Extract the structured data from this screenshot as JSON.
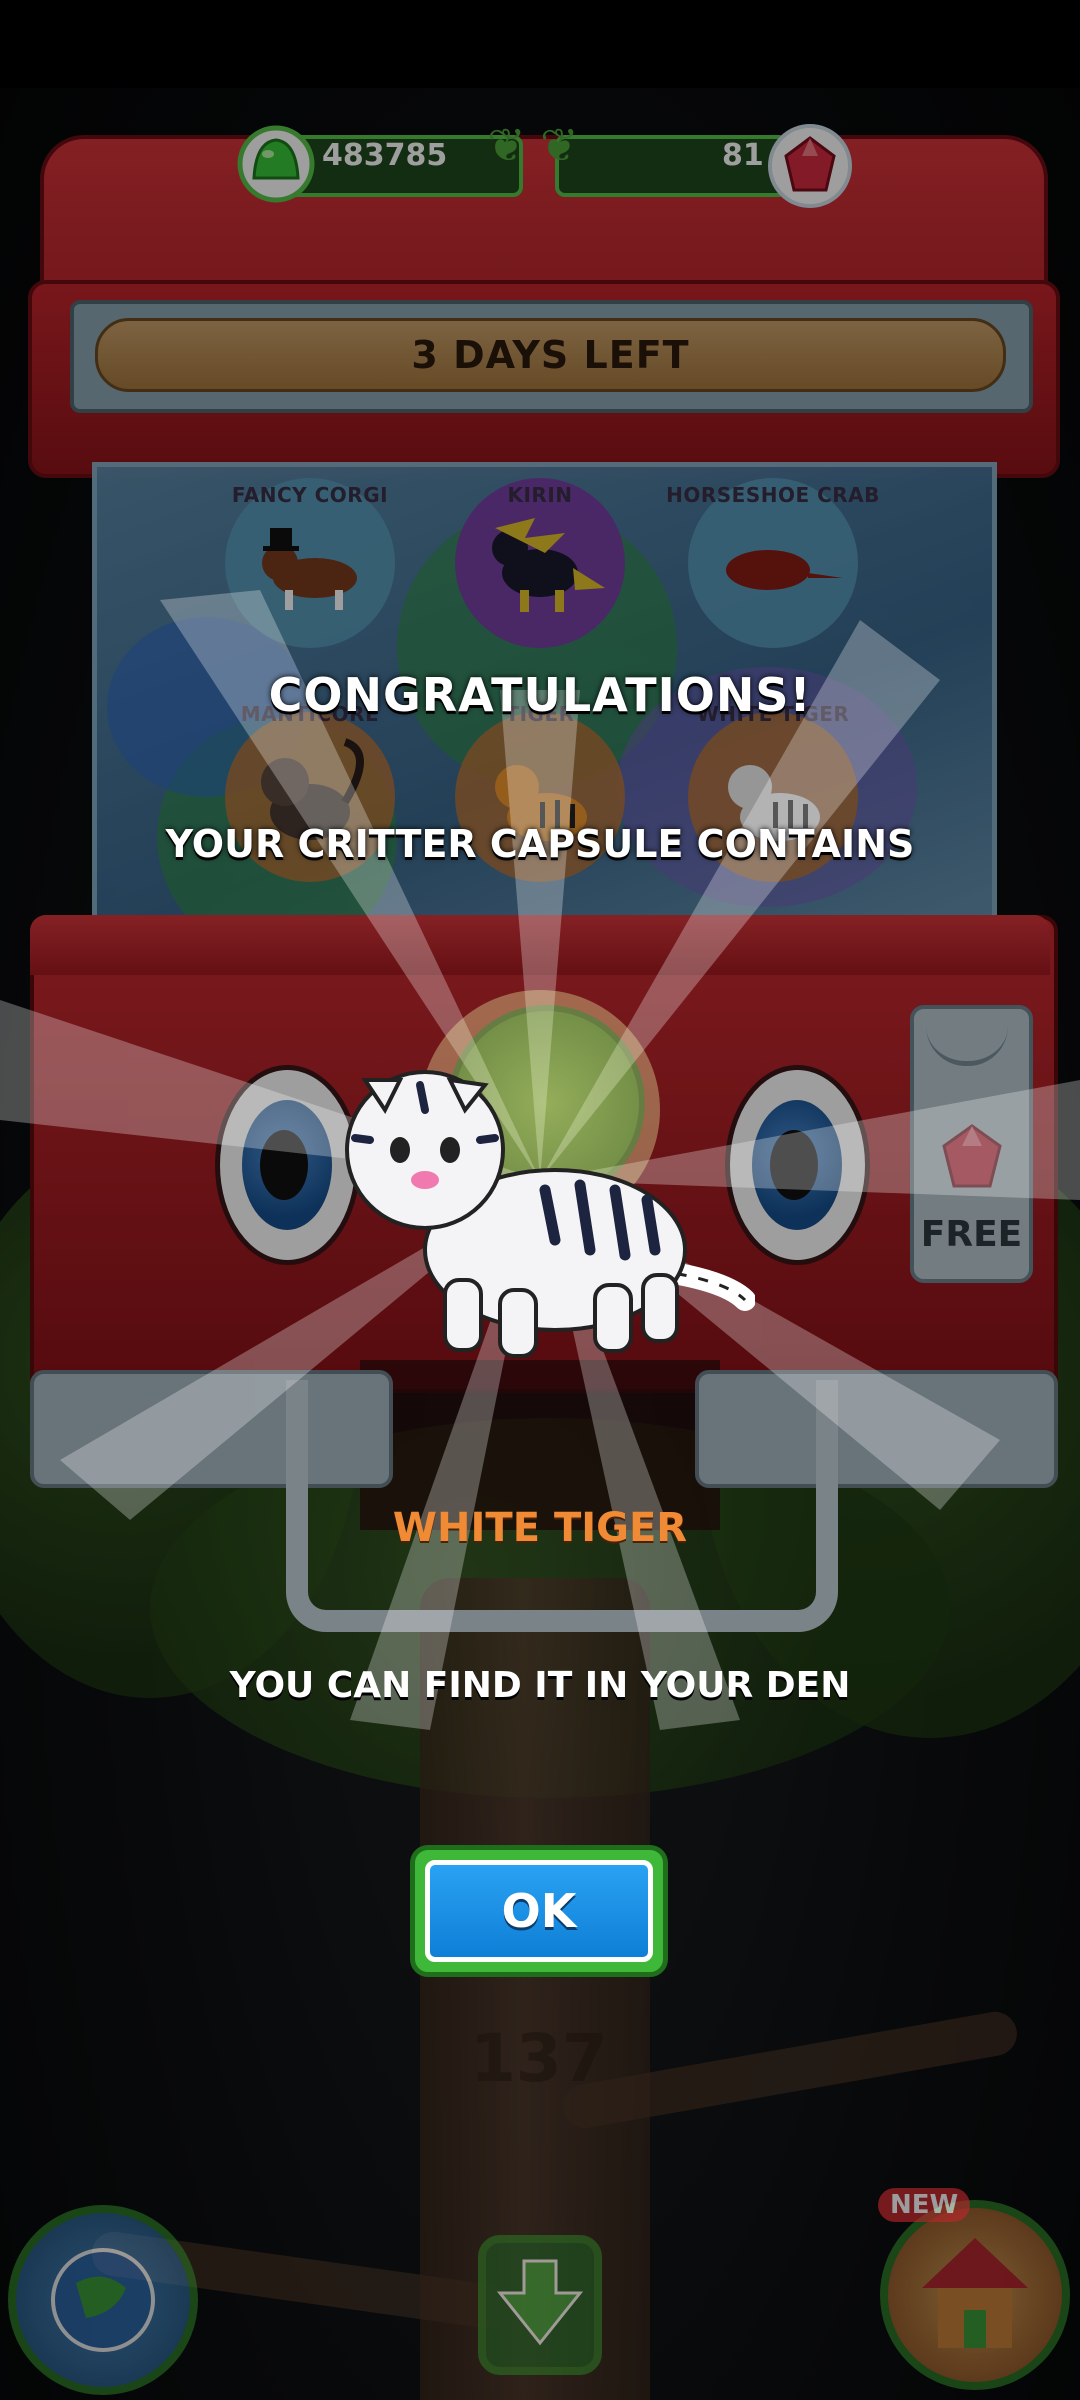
{
  "currency": {
    "slime_amount": "483785",
    "gem_amount": "81"
  },
  "machine": {
    "timer_text": "3 DAYS LEFT",
    "free_label": "FREE",
    "prizes": [
      {
        "label": "FANCY CORGI",
        "bg": "#5a9fbe"
      },
      {
        "label": "KIRIN",
        "bg": "#7a3ea8"
      },
      {
        "label": "HORSESHOE CRAB",
        "bg": "#5a9fbe"
      },
      {
        "label": "MANTICORE",
        "bg": "#b8763a"
      },
      {
        "label": "TIGER",
        "bg": "#b8763a"
      },
      {
        "label": "WHITE TIGER",
        "bg": "#b8763a"
      }
    ]
  },
  "reward": {
    "title": "CONGRATULATIONS!",
    "subtitle": "YOUR CRITTER CAPSULE CONTAINS",
    "critter_name": "WHITE TIGER",
    "message": "YOU CAN FIND IT IN YOUR DEN",
    "ok_label": "OK"
  },
  "tree": {
    "level_text": "137"
  },
  "bottom_nav": {
    "new_badge": "NEW"
  },
  "colors": {
    "accent_green": "#3fb83a",
    "ok_blue": "#1590e3",
    "machine_red": "#c2262d",
    "critter_orange": "#f08a34"
  }
}
